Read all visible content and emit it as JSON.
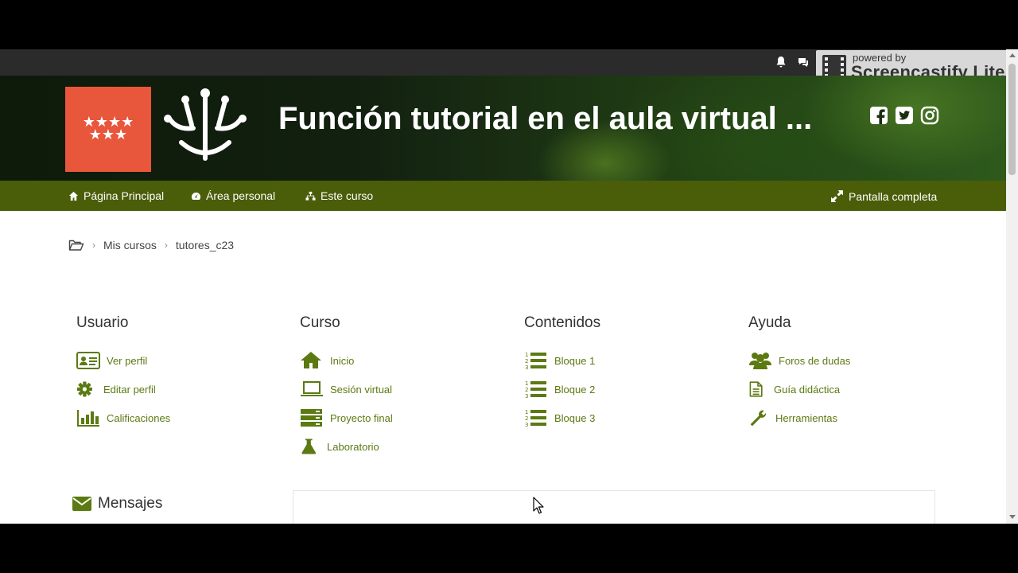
{
  "watermark": {
    "small": "powered by",
    "big": "Screencastify Lite"
  },
  "banner": {
    "title": "Función tutorial en el aula virtual ..."
  },
  "nav": {
    "home": "Página Principal",
    "personal": "Área personal",
    "course": "Este curso",
    "fullscreen": "Pantalla completa"
  },
  "breadcrumb": {
    "items": [
      "Mis cursos",
      "tutores_c23"
    ]
  },
  "columns": [
    {
      "title": "Usuario",
      "links": [
        "Ver perfil",
        "Editar perfil",
        "Calificaciones"
      ]
    },
    {
      "title": "Curso",
      "links": [
        "Inicio",
        "Sesión virtual",
        "Proyecto final",
        "Laboratorio"
      ]
    },
    {
      "title": "Contenidos",
      "links": [
        "Bloque 1",
        "Bloque 2",
        "Bloque 3"
      ]
    },
    {
      "title": "Ayuda",
      "links": [
        "Foros de dudas",
        "Guía didáctica",
        "Herramientas"
      ]
    }
  ],
  "messages": {
    "title": "Mensajes"
  },
  "colors": {
    "nav": "#4a5d09",
    "link": "#5b7a12",
    "logo": "#e8563c"
  },
  "icons": [
    "bell-icon",
    "chat-icon",
    "facebook-icon",
    "twitter-icon",
    "instagram-icon",
    "home-icon",
    "dashboard-icon",
    "sitemap-icon",
    "expand-icon",
    "folder-open-icon",
    "id-card-icon",
    "gear-icon",
    "bar-chart-icon",
    "laptop-icon",
    "server-icon",
    "flask-icon",
    "list-ol-icon",
    "users-icon",
    "document-icon",
    "wrench-icon",
    "envelope-icon"
  ]
}
